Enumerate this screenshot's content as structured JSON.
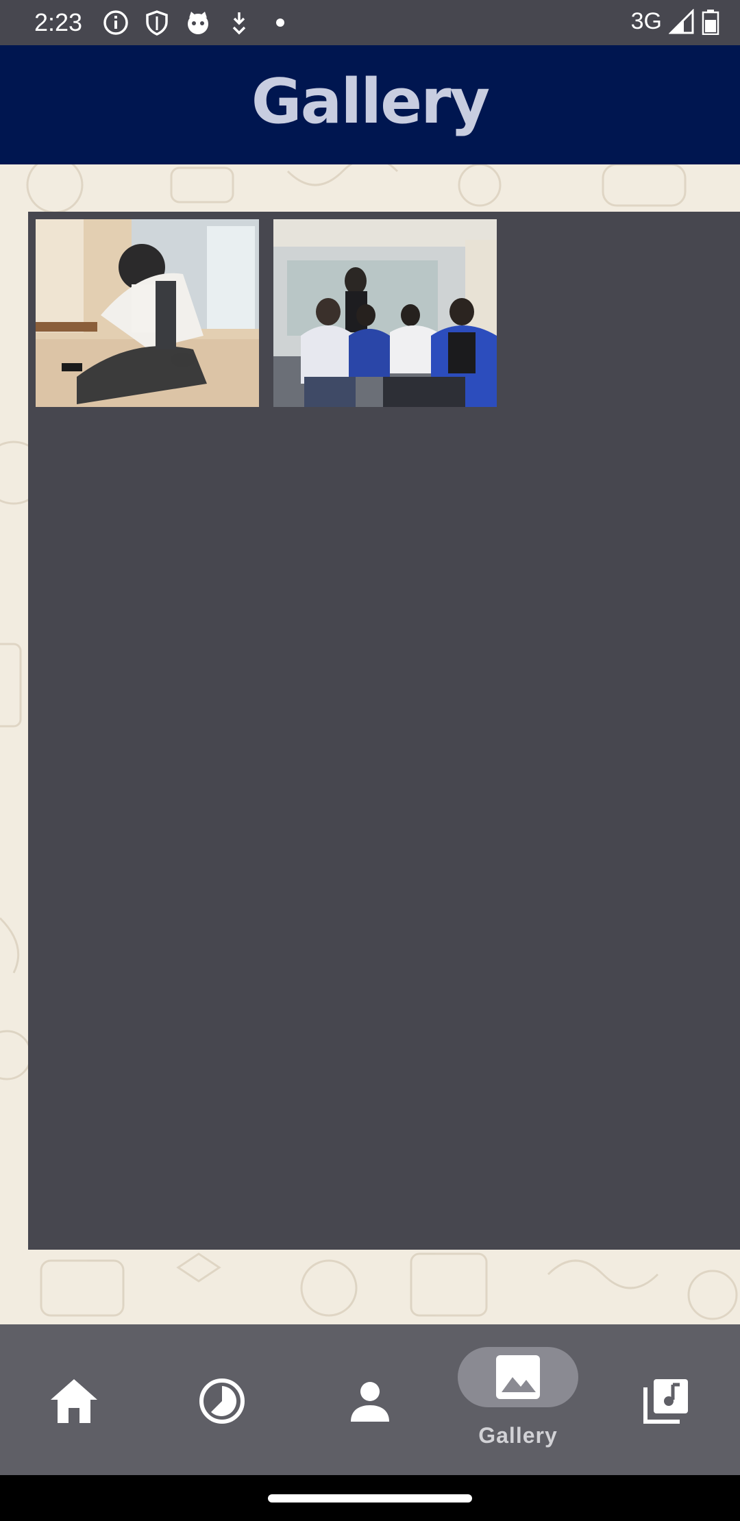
{
  "status_bar": {
    "time": "2:23",
    "network": "3G",
    "icons": [
      "info-icon",
      "shield-icon",
      "cat-face-icon",
      "download-icon",
      "dot-icon"
    ]
  },
  "header": {
    "title": "Gallery"
  },
  "gallery": {
    "photos": [
      {
        "name": "photo-man-with-phone",
        "description_icon": "photo-thumbnail"
      },
      {
        "name": "photo-group-seated",
        "description_icon": "photo-thumbnail"
      }
    ]
  },
  "bottom_nav": {
    "items": [
      {
        "icon": "home-icon",
        "label": ""
      },
      {
        "icon": "clock-pie-icon",
        "label": ""
      },
      {
        "icon": "person-icon",
        "label": ""
      },
      {
        "icon": "image-icon",
        "label": "Gallery",
        "active": true
      },
      {
        "icon": "music-library-icon",
        "label": ""
      }
    ]
  },
  "colors": {
    "status_bar": "#47474f",
    "app_bar": "#001650",
    "title": "#c8cde0",
    "panel": "#47474f",
    "background": "#f2ece0",
    "bottom_nav": "#5f5f66",
    "active_pill": "#8a8a92"
  }
}
